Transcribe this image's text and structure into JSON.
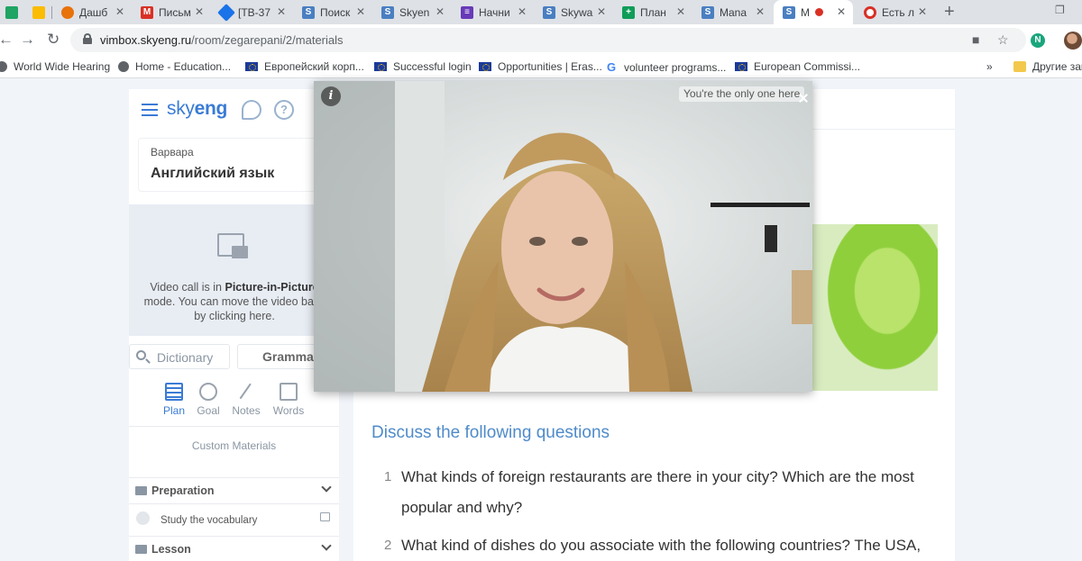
{
  "browser": {
    "tabs": [
      {
        "label": "",
        "fav": "drive-icon",
        "color": "#1fa463"
      },
      {
        "label": "Дашб",
        "fav": "dash-icon",
        "color": "#e8710a"
      },
      {
        "label": "Письм",
        "fav": "gmail-icon",
        "color": "#d93025"
      },
      {
        "label": "[ТВ-37",
        "fav": "diamond-icon",
        "color": "#1a73e8"
      },
      {
        "label": "Поиск",
        "fav": "skyeng-s-icon",
        "color": "#4a7fc1"
      },
      {
        "label": "Skyen",
        "fav": "skyeng-s-icon",
        "color": "#4a7fc1"
      },
      {
        "label": "Начни",
        "fav": "forms-icon",
        "color": "#673ab7"
      },
      {
        "label": "Skywa",
        "fav": "skyeng-s-icon",
        "color": "#4a7fc1"
      },
      {
        "label": "План",
        "fav": "sheets-icon",
        "color": "#0f9d58"
      },
      {
        "label": "Mana",
        "fav": "skyeng-s-icon",
        "color": "#4a7fc1"
      },
      {
        "label": "М",
        "fav": "skyeng-s-icon",
        "color": "#4a7fc1"
      },
      {
        "label": "Есть л",
        "fav": "lifebuoy-icon",
        "color": "#d93025"
      }
    ],
    "new_tab": "+",
    "url_host": "vimbox.skyeng.ru",
    "url_path": "/room/zegarepani/2/materials",
    "profile_letter": "N",
    "bookmarks": [
      {
        "label": "World Wide Hearing",
        "icon": "globe-icon"
      },
      {
        "label": "Home - Education...",
        "icon": "globe-icon"
      },
      {
        "label": "Европейский корп...",
        "icon": "eu-flag-icon"
      },
      {
        "label": "Successful login",
        "icon": "eu-flag-icon"
      },
      {
        "label": "Opportunities | Eras...",
        "icon": "eu-flag-icon"
      },
      {
        "label": "volunteer programs...",
        "icon": "google-icon"
      },
      {
        "label": "European Commissi...",
        "icon": "eu-flag-icon"
      }
    ],
    "more_bookmarks": "»",
    "other_bookmarks": "Другие зак"
  },
  "sidebar": {
    "logo": "skyeng",
    "chat_icon": "chat-bubble-icon",
    "help_icon": "?",
    "student_name": "Варвара",
    "course": "Английский язык",
    "pip_notice_1": "Video call is in",
    "pip_notice_bold": "Picture-in-Picture",
    "pip_notice_2": "mode. You can move the video back by clicking here.",
    "dictionary_placeholder": "Dictionary",
    "grammar_label": "Grammar",
    "tabs": [
      {
        "label": "Plan",
        "icon": "plan-icon"
      },
      {
        "label": "Goal",
        "icon": "goal-icon"
      },
      {
        "label": "Notes",
        "icon": "notes-icon"
      },
      {
        "label": "Words",
        "icon": "words-icon"
      }
    ],
    "custom_materials": "Custom Materials",
    "sections": [
      {
        "label": "Preparation"
      },
      {
        "label": "Lesson"
      }
    ],
    "items": [
      {
        "label": "Study the vocabulary"
      }
    ]
  },
  "main": {
    "section_title": "Discuss the following questions",
    "questions": [
      {
        "num": "1",
        "text": "What kinds of foreign restaurants are there in your city? Which are the most popular and why?"
      },
      {
        "num": "2",
        "text": "What kind of dishes do you associate with the following countries? The USA,"
      }
    ]
  },
  "pip_window": {
    "info": "i",
    "status": "You're the only one here"
  },
  "colors": {
    "accent": "#3a7bd5",
    "title_blue": "#4f8bc9",
    "page_bg": "#f1f5fa"
  }
}
